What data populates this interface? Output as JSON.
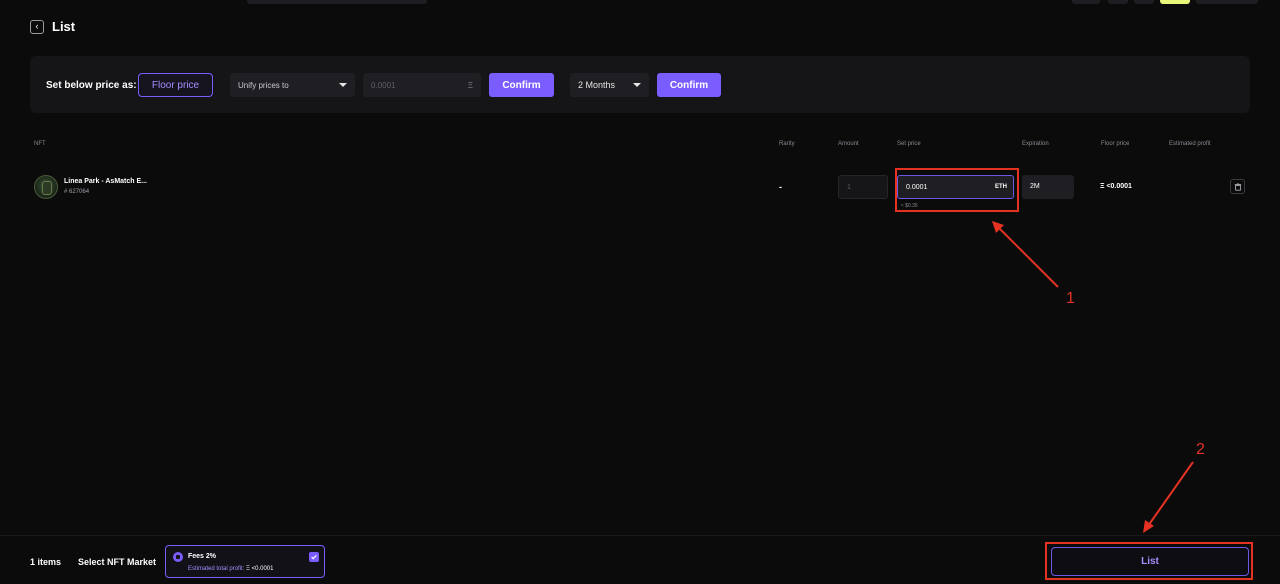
{
  "header": {
    "title": "List"
  },
  "toolbar": {
    "label": "Set below price as:",
    "floor_price_label": "Floor price",
    "unify_select": "Unify prices to",
    "price_placeholder": "0.0001",
    "eth_symbol": "Ξ",
    "confirm_label": "Confirm",
    "duration_select": "2 Months",
    "confirm2_label": "Confirm"
  },
  "table": {
    "headers": [
      "NFT",
      "Rarity",
      "Amount",
      "Set price",
      "Expiration",
      "Floor price",
      "Estimated profit"
    ],
    "rows": [
      {
        "name": "Linea Park - AsMatch E...",
        "token_id": "# 627064",
        "rarity": "-",
        "amount": "1",
        "set_price": "0.0001",
        "unit": "ETH",
        "usd": "≈ $0.35",
        "expiration": "2M",
        "floor_price": "Ξ <0.0001"
      }
    ]
  },
  "footer": {
    "items_count": "1 items",
    "market_label": "Select NFT Market",
    "market_fees": "Fees 2%",
    "estimated_label": "Estimated total profit:",
    "estimated_value": "Ξ <0.0001",
    "list_button": "List"
  },
  "annotations": {
    "one": "1",
    "two": "2"
  },
  "colors": {
    "accent": "#7b5cff",
    "annotation": "#e53222",
    "background": "#0b0b0c"
  }
}
